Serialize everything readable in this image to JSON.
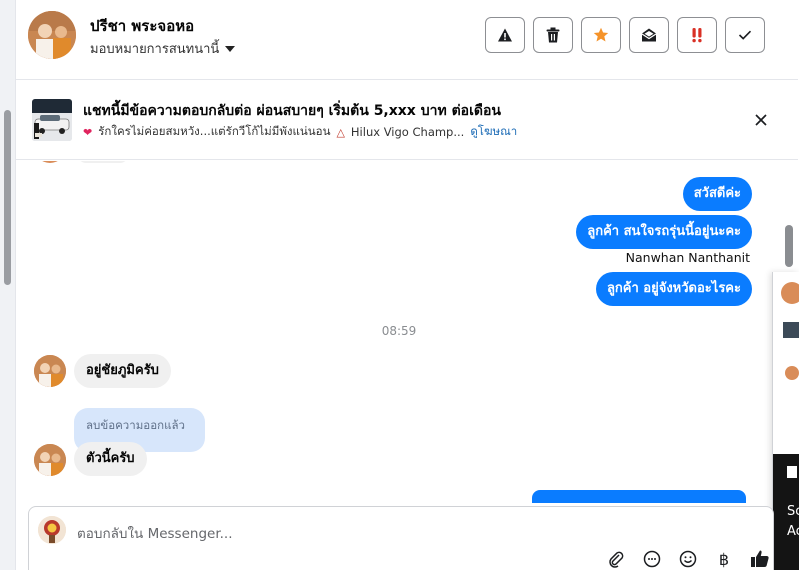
{
  "header": {
    "contact_name": "ปรีชา พระจอหอ",
    "assign_label": "มอบหมายการสนทนานี้",
    "actions": [
      {
        "name": "report-spam-button",
        "icon": "warning-icon"
      },
      {
        "name": "delete-button",
        "icon": "trash-icon"
      },
      {
        "name": "star-button",
        "icon": "star-icon"
      },
      {
        "name": "mark-unread-button",
        "icon": "envelope-open-icon"
      },
      {
        "name": "follow-up-button",
        "icon": "exclamation-icon"
      },
      {
        "name": "mark-done-button",
        "icon": "check-icon"
      }
    ]
  },
  "ad": {
    "title": "แชทนี้มีข้อความตอบกลับต่อ ผ่อนสบายๆ เริ่มต้น 5,xxx บาท ต่อเดือน",
    "subtitle": "รักใครไม่ค่อยสมหวัง...แต่รักวีโก้ไม่มีพังแน่นอน",
    "model": "Hilux Vigo Champ...",
    "link_label": "ดูโฆษณา"
  },
  "thread": {
    "outgoing": [
      {
        "text": "สวัสดีค่ะ"
      },
      {
        "text": "ลูกค้า สนใจรถรุ่นนี้อยู่นะคะ"
      },
      {
        "text": "ลูกค้า อยู่จังหวัดอะไรคะ"
      }
    ],
    "sender_name": "Nanwhan Nanthanit",
    "time_separator": "08:59",
    "incoming": [
      {
        "text": "อยู่ชัยภูมิครับ"
      },
      {
        "text": "ตัวนี้ครับ"
      }
    ],
    "deleted_notice": "ลบข้อความออกแล้ว"
  },
  "side_panel": {
    "text_lines": [
      "Sc",
      "Ac"
    ]
  },
  "composer": {
    "placeholder": "ตอบกลับใน Messenger...",
    "tools": [
      "paperclip-icon",
      "chat-bubble-icon",
      "smiley-icon",
      "baht-icon",
      "thumbs-up-icon"
    ]
  },
  "colors": {
    "accent": "#0a7cff",
    "incoming_bubble": "#f0f0f0",
    "deleted_bubble": "#d7e6fb",
    "link": "#1a6ab5"
  }
}
